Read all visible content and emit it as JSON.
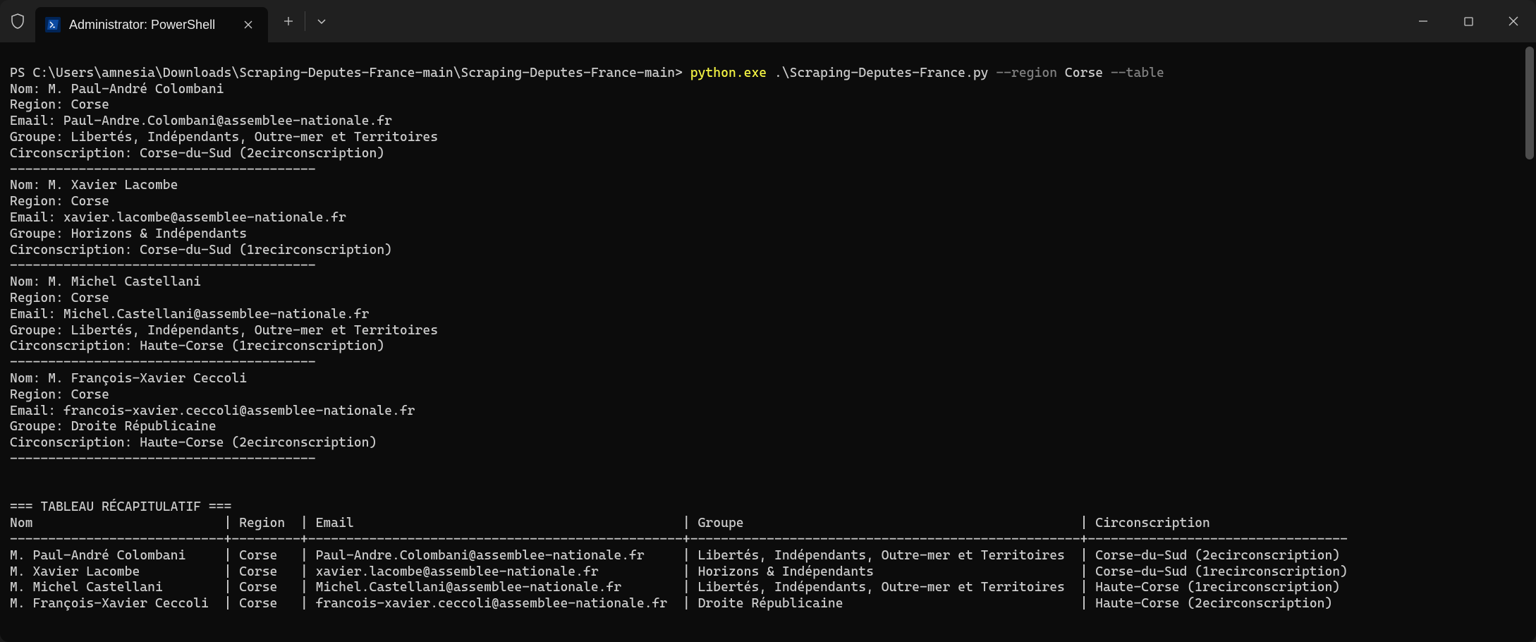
{
  "tab": {
    "title": "Administrator: PowerShell"
  },
  "prompt": {
    "path": "PS C:\\Users\\amnesia\\Downloads\\Scraping-Deputes-France-main\\Scraping-Deputes-France-main> ",
    "exe": "python.exe",
    "script": " .\\Scraping-Deputes-France.py ",
    "flag1": "--region",
    "arg1": " Corse ",
    "flag2": "--table"
  },
  "sep": "----------------------------------------",
  "deputes": [
    {
      "nom": "M. Paul-André Colombani",
      "region": "Corse",
      "email": "Paul-Andre.Colombani@assemblee-nationale.fr",
      "groupe": "Libertés, Indépendants, Outre-mer et Territoires",
      "circ": "Corse-du-Sud (2ecirconscription)"
    },
    {
      "nom": "M. Xavier Lacombe",
      "region": "Corse",
      "email": "xavier.lacombe@assemblee-nationale.fr",
      "groupe": "Horizons & Indépendants",
      "circ": "Corse-du-Sud (1recirconscription)"
    },
    {
      "nom": "M. Michel Castellani",
      "region": "Corse",
      "email": "Michel.Castellani@assemblee-nationale.fr",
      "groupe": "Libertés, Indépendants, Outre-mer et Territoires",
      "circ": "Haute-Corse (1recirconscription)"
    },
    {
      "nom": "M. François-Xavier Ceccoli",
      "region": "Corse",
      "email": "francois-xavier.ceccoli@assemblee-nationale.fr",
      "groupe": "Droite Républicaine",
      "circ": "Haute-Corse (2ecirconscription)"
    }
  ],
  "labels": {
    "nom": "Nom: ",
    "region": "Region: ",
    "email": "Email: ",
    "groupe": "Groupe: ",
    "circ": "Circonscription: "
  },
  "table": {
    "title": "=== TABLEAU RÉCAPITULATIF ===",
    "header": "Nom                         | Region  | Email                                           | Groupe                                            | Circonscription",
    "rule": "----------------------------+---------+-------------------------------------------------+---------------------------------------------------+----------------------------------",
    "rows": [
      "M. Paul-André Colombani     | Corse   | Paul-Andre.Colombani@assemblee-nationale.fr     | Libertés, Indépendants, Outre-mer et Territoires  | Corse-du-Sud (2ecirconscription)",
      "M. Xavier Lacombe           | Corse   | xavier.lacombe@assemblee-nationale.fr           | Horizons & Indépendants                           | Corse-du-Sud (1recirconscription)",
      "M. Michel Castellani        | Corse   | Michel.Castellani@assemblee-nationale.fr        | Libertés, Indépendants, Outre-mer et Territoires  | Haute-Corse (1recirconscription)",
      "M. François-Xavier Ceccoli  | Corse   | francois-xavier.ceccoli@assemblee-nationale.fr  | Droite Républicaine                               | Haute-Corse (2ecirconscription)"
    ]
  }
}
